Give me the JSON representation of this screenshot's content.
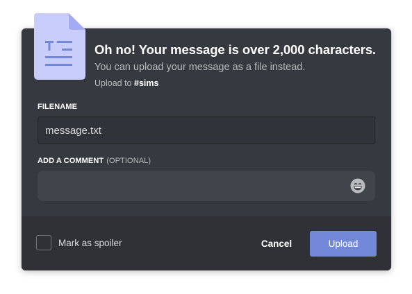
{
  "header": {
    "title": "Oh no! Your message is over 2,000 characters.",
    "subtitle": "You can upload your message as a file instead.",
    "upload_to_prefix": "Upload to",
    "channel": "#sims"
  },
  "form": {
    "filename_label": "Filename",
    "filename_value": "message.txt",
    "comment_label": "Add a comment",
    "comment_optional": "(Optional)",
    "comment_value": ""
  },
  "footer": {
    "spoiler_label": "Mark as spoiler",
    "spoiler_checked": false,
    "cancel_label": "Cancel",
    "upload_label": "Upload"
  },
  "icons": {
    "file": "text-file-icon",
    "emoji": "grinning-emoji-icon"
  },
  "colors": {
    "modal_bg": "#36393f",
    "footer_bg": "#2f3136",
    "accent": "#7289da",
    "file_icon": "#c9cdfb",
    "file_icon_fold": "#a3abf5",
    "file_icon_lines": "#7289da"
  }
}
